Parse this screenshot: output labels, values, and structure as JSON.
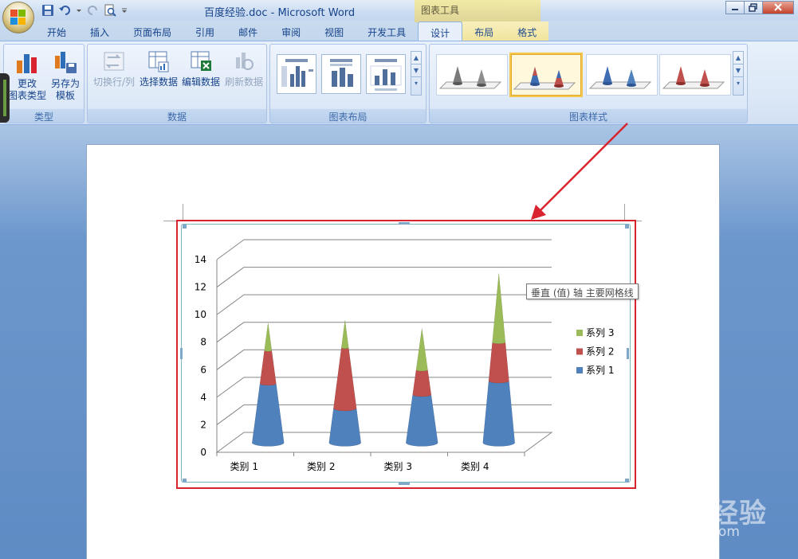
{
  "title_bar": {
    "window_title": "百度经验.doc - Microsoft Word",
    "contextual_title": "图表工具"
  },
  "tabs": [
    {
      "label": "开始"
    },
    {
      "label": "插入"
    },
    {
      "label": "页面布局"
    },
    {
      "label": "引用"
    },
    {
      "label": "邮件"
    },
    {
      "label": "审阅"
    },
    {
      "label": "视图"
    },
    {
      "label": "开发工具"
    },
    {
      "label": "设计",
      "active": true
    },
    {
      "label": "布局"
    },
    {
      "label": "格式"
    }
  ],
  "ribbon": {
    "type_group": {
      "label": "类型",
      "change_type": "更改\n图表类型",
      "save_template": "另存为\n模板"
    },
    "data_group": {
      "label": "数据",
      "switch_row_col": "切换行/列",
      "select_data": "选择数据",
      "edit_data": "编辑数据",
      "refresh_data": "刷新数据"
    },
    "layout_group": {
      "label": "图表布局"
    },
    "styles_group": {
      "label": "图表样式"
    }
  },
  "tooltip": "垂直 (值) 轴 主要网格线",
  "watermark": {
    "brand": "Baidu经验",
    "url": "jingyan.baidu.com"
  },
  "colors": {
    "series1": "#4f81bd",
    "series2": "#c0504d",
    "series3": "#9bbb59",
    "annotation": "#d9232e"
  },
  "chart_data": {
    "type": "bar",
    "subtype": "3d-stacked-cone",
    "categories": [
      "类别 1",
      "类别 2",
      "类别 3",
      "类别 4"
    ],
    "series": [
      {
        "name": "系列 1",
        "values": [
          4.3,
          2.5,
          3.5,
          4.5
        ]
      },
      {
        "name": "系列 2",
        "values": [
          2.4,
          4.4,
          1.8,
          2.8
        ]
      },
      {
        "name": "系列 3",
        "values": [
          2,
          2,
          3,
          5
        ]
      }
    ],
    "yticks": [
      "0",
      "2",
      "4",
      "6",
      "8",
      "10",
      "12",
      "14"
    ],
    "ylim": [
      0,
      14
    ],
    "grid": true,
    "legend": "right"
  }
}
